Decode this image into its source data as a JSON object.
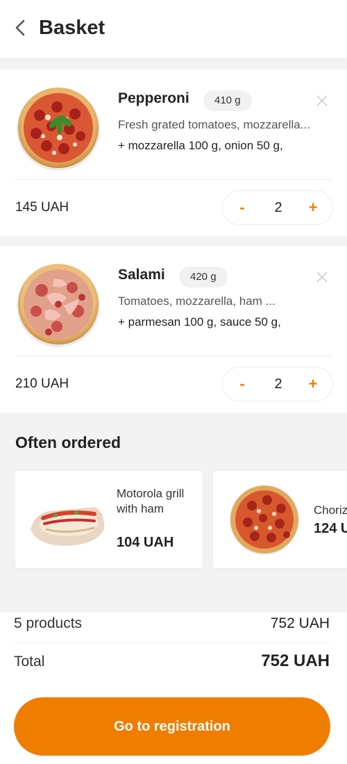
{
  "header": {
    "title": "Basket",
    "back_icon": "back-arrow-icon"
  },
  "cart": [
    {
      "name": "Pepperoni",
      "weight": "410 g",
      "description": "Fresh grated tomatoes, mozzarella...",
      "additions": "+ mozzarella 100 g, onion 50 g,",
      "price": "145 UAH",
      "quantity": "2",
      "minus_label": "-",
      "plus_label": "+"
    },
    {
      "name": "Salami",
      "weight": "420 g",
      "description": "Tomatoes, mozzarella, ham ...",
      "additions": "+ parmesan 100 g, sauce 50 g,",
      "price": "210 UAH",
      "quantity": "2",
      "minus_label": "-",
      "plus_label": "+"
    }
  ],
  "often_ordered": {
    "title": "Often ordered",
    "items": [
      {
        "name": "Motorola grill with ham",
        "price": "104 UAH"
      },
      {
        "name": "Choriz",
        "price": "124 U"
      }
    ]
  },
  "summary": {
    "products_count": "5 products",
    "products_total": "752 UAH",
    "total_label": "Total",
    "total_value": "752 UAH",
    "cta_label": "Go to registration"
  },
  "colors": {
    "accent": "#ef7d00",
    "background": "#f3f3f3"
  }
}
